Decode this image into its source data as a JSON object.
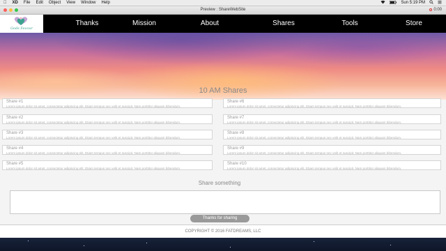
{
  "menubar": {
    "items": [
      "XD",
      "File",
      "Edit",
      "Object",
      "View",
      "Window",
      "Help"
    ],
    "time": "Sun 5:19 PM"
  },
  "window": {
    "title": "Preview : ShareWebSite"
  },
  "site": {
    "logo_text": "Gods Favour",
    "nav": [
      "Thanks",
      "Mission",
      "About",
      "Shares",
      "Tools",
      "Store"
    ],
    "section_title": "10 AM Shares",
    "shares": [
      {
        "title": "Share #1",
        "body": "Lorem ipsum dolor sit amet, consectetur adipiscing elit. Etiam tempus nec velit et suscipit. Nam porttitor aliquam bibendum."
      },
      {
        "title": "Share #6",
        "body": "Lorem ipsum dolor sit amet, consectetur adipiscing elit. Etiam tempus nec velit et suscipit. Nam porttitor aliquam bibendum."
      },
      {
        "title": "Share #2",
        "body": "Lorem ipsum dolor sit amet, consectetur adipiscing elit. Etiam tempus nec velit et suscipit. Nam porttitor aliquam bibendum."
      },
      {
        "title": "Share #7",
        "body": "Lorem ipsum dolor sit amet, consectetur adipiscing elit. Etiam tempus nec velit et suscipit. Nam porttitor aliquam bibendum."
      },
      {
        "title": "Share #3",
        "body": "Lorem ipsum dolor sit amet, consectetur adipiscing elit. Etiam tempus nec velit et suscipit. Nam porttitor aliquam bibendum."
      },
      {
        "title": "Share #8",
        "body": "Lorem ipsum dolor sit amet, consectetur adipiscing elit. Etiam tempus nec velit et suscipit. Nam porttitor aliquam bibendum."
      },
      {
        "title": "Share #4",
        "body": "Lorem ipsum dolor sit amet, consectetur adipiscing elit. Etiam tempus nec velit et suscipit. Nam porttitor aliquam bibendum."
      },
      {
        "title": "Share #9",
        "body": "Lorem ipsum dolor sit amet, consectetur adipiscing elit. Etiam tempus nec velit et suscipit. Nam porttitor aliquam bibendum."
      },
      {
        "title": "Share #5",
        "body": "Lorem ipsum dolor sit amet, consectetur adipiscing elit. Etiam tempus nec velit et suscipit. Nam porttitor aliquam bibendum."
      },
      {
        "title": "Share #10",
        "body": "Lorem ipsum dolor sit amet, consectetur adipiscing elit. Etiam tempus nec velit et suscipit. Nam porttitor aliquam bibendum."
      }
    ],
    "share_heading": "Share something",
    "share_input_value": "",
    "submit_label": "Thanks for sharing",
    "footer": "COPYRIGHT © 2016 FATDREAMS, LLC"
  },
  "colors": {
    "nav_bg": "#000000",
    "logo_accent": "#3aa38f",
    "button_bg": "#9a9a9a"
  },
  "icons": [
    "apple-icon",
    "record-icon",
    "heart-logo-icon"
  ]
}
